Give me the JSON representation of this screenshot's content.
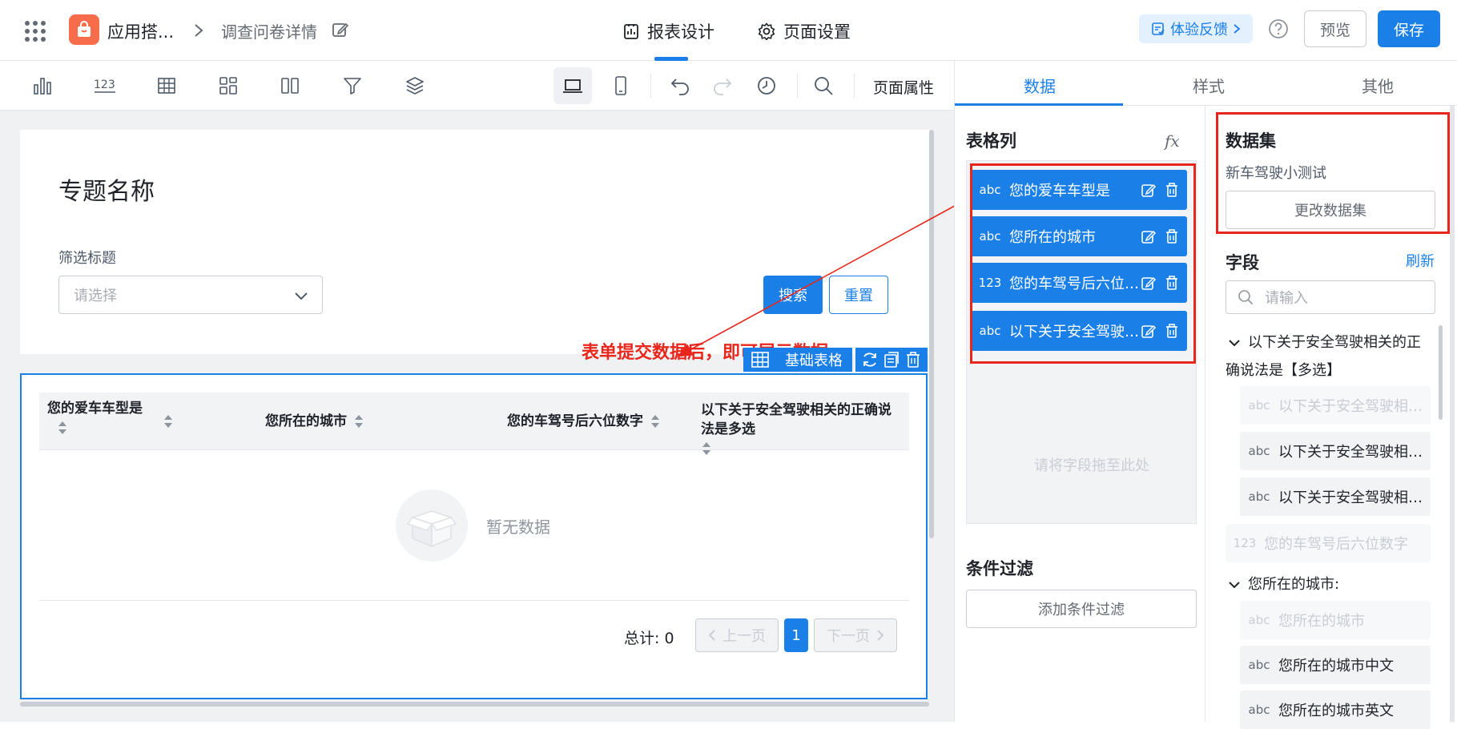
{
  "header": {
    "app_name": "应用搭...",
    "breadcrumb_page": "调查问卷详情",
    "tabs": [
      {
        "label": "报表设计",
        "active": true
      },
      {
        "label": "页面设置",
        "active": false
      }
    ],
    "feedback_label": "体验反馈",
    "preview_label": "预览",
    "save_label": "保存"
  },
  "toolbar": {
    "page_properties_label": "页面属性"
  },
  "canvas": {
    "topic_title": "专题名称",
    "filter_label": "筛选标题",
    "select_placeholder": "请选择",
    "search_label": "搜索",
    "reset_label": "重置",
    "annotation": "表单提交数据后，即可展示数据",
    "table_tag_label": "基础表格",
    "table": {
      "columns": [
        "您的爱车车型是",
        "您所在的城市",
        "您的车驾号后六位数字",
        "以下关于安全驾驶相关的正确说法是多选"
      ],
      "empty_text": "暂无数据",
      "total_label": "总计: 0",
      "prev_label": "上一页",
      "next_label": "下一页",
      "current_page": "1"
    }
  },
  "right_panel": {
    "tabs": [
      {
        "label": "数据",
        "active": true
      },
      {
        "label": "样式",
        "active": false
      },
      {
        "label": "其他",
        "active": false
      }
    ],
    "columns_title": "表格列",
    "fx_label": "fx",
    "column_chips": [
      {
        "type": "abc",
        "label": "您的爱车车型是"
      },
      {
        "type": "abc",
        "label": "您所在的城市"
      },
      {
        "type": "123",
        "label": "您的车驾号后六位数字"
      },
      {
        "type": "abc",
        "label": "以下关于安全驾驶相关的正确说法是"
      }
    ],
    "dropzone_hint": "请将字段拖至此处",
    "condition_title": "条件过滤",
    "add_condition_label": "添加条件过滤",
    "dataset_title": "数据集",
    "dataset_name": "新车驾驶小测试",
    "change_dataset_label": "更改数据集",
    "fields_title": "字段",
    "refresh_label": "刷新",
    "field_search_placeholder": "请输入",
    "group1_title_line1": "以下关于安全驾驶相关的正",
    "group1_title_line2": "确说法是【多选】",
    "group1_items": [
      {
        "type": "abc",
        "label": "以下关于安全驾驶相关的正确说法是",
        "dim": true
      },
      {
        "type": "abc",
        "label": "以下关于安全驾驶相关的正确说法是",
        "dim": false
      },
      {
        "type": "abc",
        "label": "以下关于安全驾驶相关的正确说法是",
        "dim": false
      }
    ],
    "standalone_item": {
      "type": "123",
      "label": "您的车驾号后六位数字"
    },
    "group2_title": "您所在的城市:",
    "group2_items": [
      {
        "type": "abc",
        "label": "您所在的城市",
        "dim": true
      },
      {
        "type": "abc",
        "label": "您所在的城市中文",
        "dim": false
      },
      {
        "type": "abc",
        "label": "您所在的城市英文",
        "dim": false
      }
    ]
  },
  "colors": {
    "primary": "#1b7fe8",
    "annotation_red": "#e8261c",
    "app_logo": "#f76c4a"
  }
}
